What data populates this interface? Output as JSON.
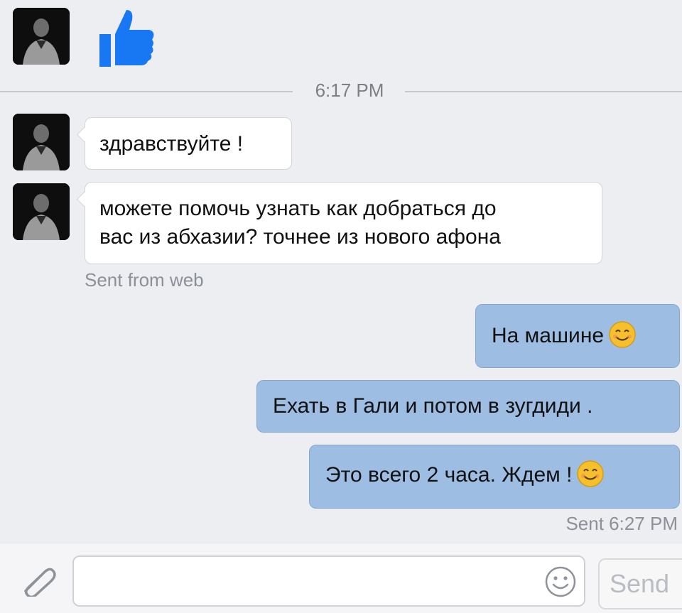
{
  "thread": {
    "divider_time": "6:17 PM",
    "incoming": [
      {
        "text": "здравствуйте !"
      },
      {
        "lines": [
          "можете помочь узнать как добраться до",
          "вас из абхазии? точнее из нового афона"
        ]
      }
    ],
    "incoming_meta": "Sent from web",
    "outgoing": [
      {
        "text": "На машине",
        "emoji": "smiling-face-emoji"
      },
      {
        "text": "Ехать в Гали и потом в зугдиди ."
      },
      {
        "text": "Это всего 2 часа. Ждем !",
        "emoji": "smiling-face-emoji"
      }
    ],
    "outgoing_meta": "Sent 6:27 PM"
  },
  "composer": {
    "placeholder": "",
    "send_label": "Send",
    "attach_icon": "paperclip-icon",
    "emoji_icon": "smiley-icon"
  },
  "colors": {
    "background": "#edeef1",
    "incoming_bubble": "#ffffff",
    "outgoing_bubble": "#9dbde3",
    "like_blue": "#1877f2"
  },
  "icons": {
    "like": "thumbs-up-icon",
    "avatar": "user-avatar"
  }
}
